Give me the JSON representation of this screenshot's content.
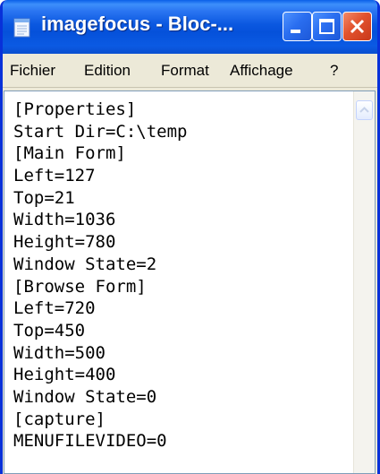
{
  "window": {
    "title": "imagefocus - Bloc-...",
    "app_icon": "notepad-icon",
    "colors": {
      "titlebar": "#0a5fe8",
      "close_button": "#e2522d",
      "frame": "#0831d9",
      "menubar": "#ece9d8"
    }
  },
  "menu": {
    "items": [
      "Fichier",
      "Edition",
      "Format",
      "Affichage",
      "?"
    ]
  },
  "editor": {
    "lines": [
      "[Properties]",
      "Start Dir=C:\\temp",
      "[Main Form]",
      "Left=127",
      "Top=21",
      "Width=1036",
      "Height=780",
      "Window State=2",
      "[Browse Form]",
      "Left=720",
      "Top=450",
      "Width=500",
      "Height=400",
      "Window State=0",
      "[capture]",
      "MENUFILEVIDEO=0"
    ]
  },
  "scrollbar": {
    "up_arrow_icon": "chevron-up-icon"
  }
}
